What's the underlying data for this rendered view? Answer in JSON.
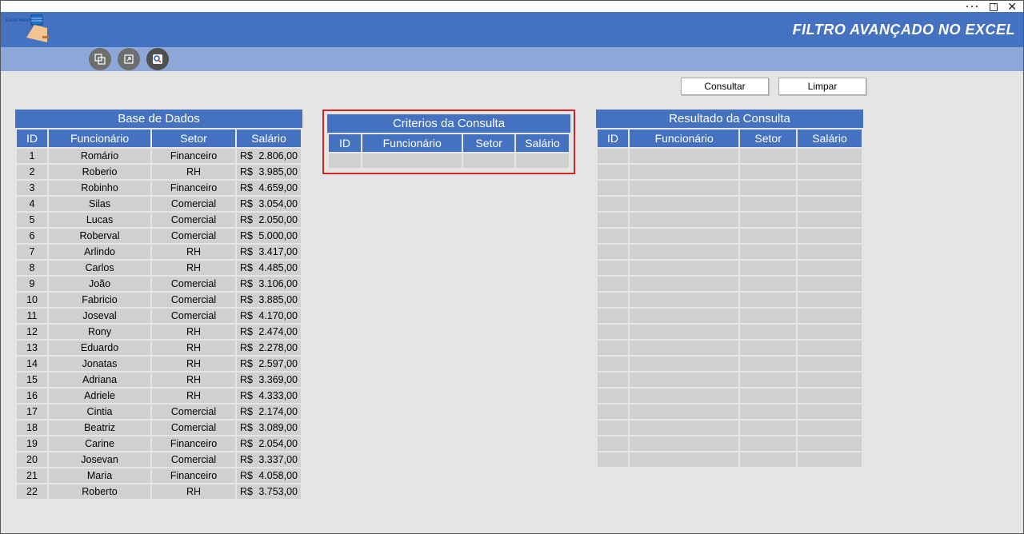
{
  "window": {
    "title_right": "FILTRO AVANÇADO NO EXCEL"
  },
  "buttons": {
    "consultar": "Consultar",
    "limpar": "Limpar"
  },
  "headers": {
    "id": "ID",
    "funcionario": "Funcionário",
    "setor": "Setor",
    "salario": "Salário"
  },
  "titles": {
    "base": "Base de Dados",
    "criterios": "Criterios da Consulta",
    "resultado": "Resultado da Consulta"
  },
  "currency": "R$",
  "base": [
    {
      "id": "1",
      "nome": "Romário",
      "setor": "Financeiro",
      "sal": "2.806,00"
    },
    {
      "id": "2",
      "nome": "Roberio",
      "setor": "RH",
      "sal": "3.985,00"
    },
    {
      "id": "3",
      "nome": "Robinho",
      "setor": "Financeiro",
      "sal": "4.659,00"
    },
    {
      "id": "4",
      "nome": "Silas",
      "setor": "Comercial",
      "sal": "3.054,00"
    },
    {
      "id": "5",
      "nome": "Lucas",
      "setor": "Comercial",
      "sal": "2.050,00"
    },
    {
      "id": "6",
      "nome": "Roberval",
      "setor": "Comercial",
      "sal": "5.000,00"
    },
    {
      "id": "7",
      "nome": "Arlindo",
      "setor": "RH",
      "sal": "3.417,00"
    },
    {
      "id": "8",
      "nome": "Carlos",
      "setor": "RH",
      "sal": "4.485,00"
    },
    {
      "id": "9",
      "nome": "João",
      "setor": "Comercial",
      "sal": "3.106,00"
    },
    {
      "id": "10",
      "nome": "Fabricio",
      "setor": "Comercial",
      "sal": "3.885,00"
    },
    {
      "id": "11",
      "nome": "Joseval",
      "setor": "Comercial",
      "sal": "4.170,00"
    },
    {
      "id": "12",
      "nome": "Rony",
      "setor": "RH",
      "sal": "2.474,00"
    },
    {
      "id": "13",
      "nome": "Eduardo",
      "setor": "RH",
      "sal": "2.278,00"
    },
    {
      "id": "14",
      "nome": "Jonatas",
      "setor": "RH",
      "sal": "2.597,00"
    },
    {
      "id": "15",
      "nome": "Adriana",
      "setor": "RH",
      "sal": "3.369,00"
    },
    {
      "id": "16",
      "nome": "Adriele",
      "setor": "RH",
      "sal": "4.333,00"
    },
    {
      "id": "17",
      "nome": "Cintia",
      "setor": "Comercial",
      "sal": "2.174,00"
    },
    {
      "id": "18",
      "nome": "Beatriz",
      "setor": "Comercial",
      "sal": "3.089,00"
    },
    {
      "id": "19",
      "nome": "Carine",
      "setor": "Financeiro",
      "sal": "2.054,00"
    },
    {
      "id": "20",
      "nome": "Josevan",
      "setor": "Comercial",
      "sal": "3.337,00"
    },
    {
      "id": "21",
      "nome": "Maria",
      "setor": "Financeiro",
      "sal": "4.058,00"
    },
    {
      "id": "22",
      "nome": "Roberto",
      "setor": "RH",
      "sal": "3.753,00"
    }
  ],
  "result_rows": 20
}
